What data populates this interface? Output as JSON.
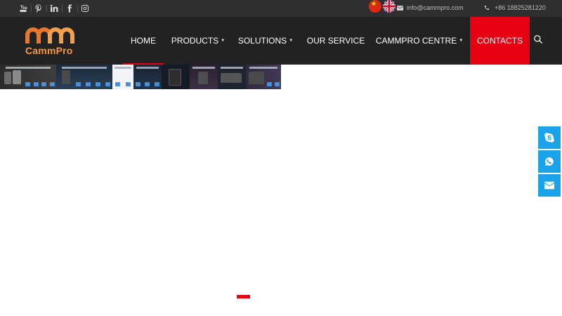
{
  "topbar": {
    "social_icons": [
      "youtube-icon",
      "pinterest-icon",
      "linkedin-icon",
      "facebook-icon",
      "instagram-icon"
    ],
    "languages": [
      "china-flag",
      "uk-flag"
    ],
    "email": "info@cammpro.com",
    "phone": "+86 18825281220"
  },
  "header": {
    "logo_text": "CammPro",
    "nav": [
      {
        "label": "HOME",
        "has_dropdown": false,
        "active": false
      },
      {
        "label": "PRODUCTS",
        "has_dropdown": true,
        "active": false
      },
      {
        "label": "SOLUTIONS",
        "has_dropdown": true,
        "active": false
      },
      {
        "label": "OUR SERVICE",
        "has_dropdown": false,
        "active": false
      },
      {
        "label": "CAMMPRO CENTRE",
        "has_dropdown": true,
        "active": false
      },
      {
        "label": "CONTACTS",
        "has_dropdown": false,
        "active": true
      }
    ]
  },
  "side_buttons": [
    "skype-icon",
    "whatsapp-icon",
    "mail-icon"
  ],
  "colors": {
    "accent_red": "#e60012",
    "logo_orange": "#f2994a",
    "header_bg": "#222222",
    "topbar_bg": "#2f2f2f",
    "side_blue": "#1aa3e8"
  }
}
